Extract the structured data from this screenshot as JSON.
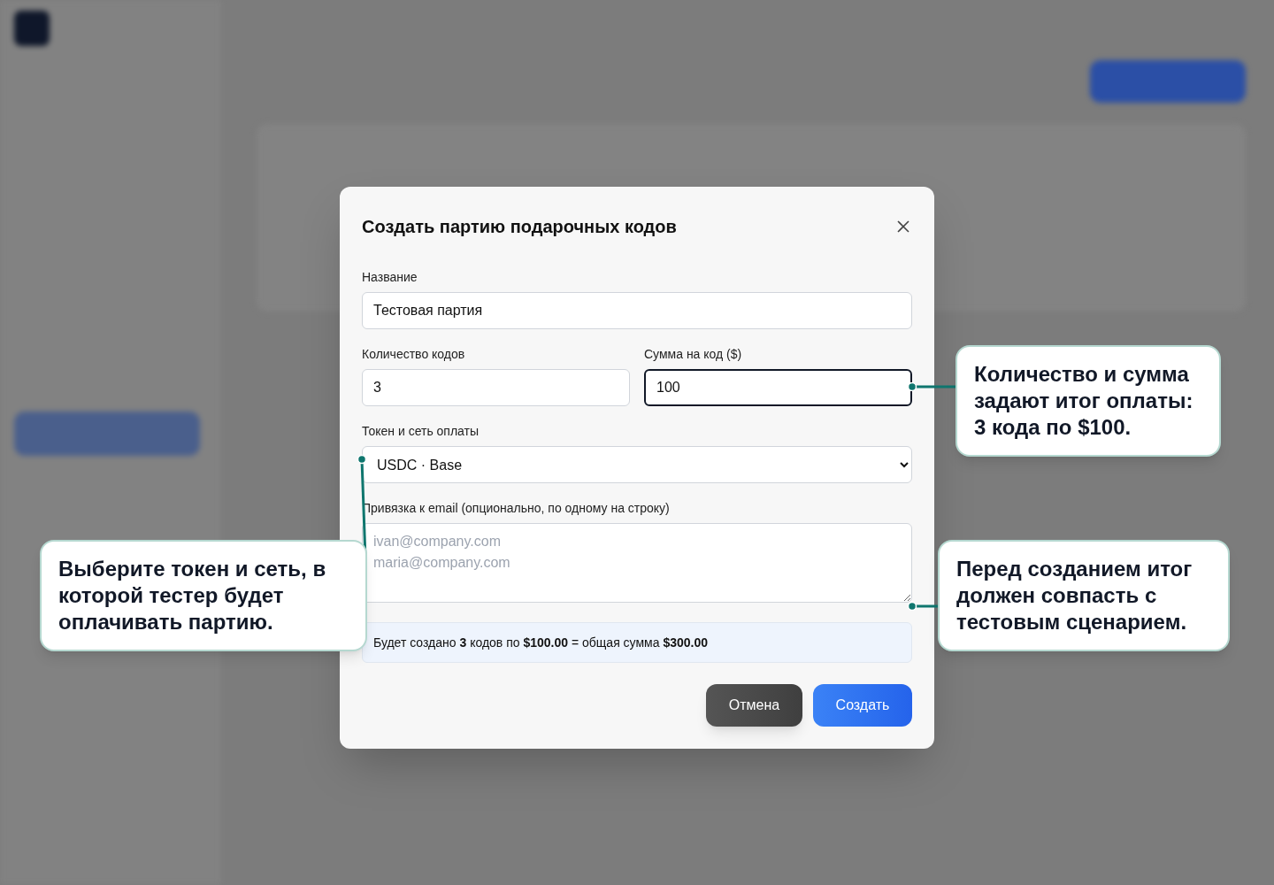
{
  "dialog": {
    "title": "Создать партию подарочных кодов",
    "rows": [
      [
        {
          "kind": "text",
          "label": "Название",
          "value": "Тестовая партия",
          "focused": false
        }
      ],
      [
        {
          "kind": "text",
          "label": "Количество кодов",
          "value": "3",
          "focused": false
        },
        {
          "kind": "text",
          "label": "Сумма на код ($)",
          "value": "100",
          "focused": true
        }
      ],
      [
        {
          "kind": "select",
          "label": "Токен и сеть оплаты",
          "value": "USDC · Base",
          "focused": false
        }
      ],
      [
        {
          "kind": "textarea",
          "label": "Привязка к email (опционально, по одному на строку)",
          "placeholder": "ivan@company.com\nmaria@company.com",
          "focused": false
        }
      ]
    ],
    "summary": "Будет создано **3** кодов по **$100.00** = общая сумма **$300.00**",
    "buttons": [
      {
        "kind": "secondary",
        "label": "Отмена"
      },
      {
        "kind": "primary",
        "label": "Создать"
      }
    ]
  },
  "callouts": [
    {
      "text": "Количество и сумма задают итог оплаты: 3 кода по $100."
    },
    {
      "text": "Выберите токен и сеть, в которой тестер будет оплачивать партию."
    },
    {
      "text": "Перед созданием итог должен совпасть с тестовым сценарием."
    }
  ]
}
